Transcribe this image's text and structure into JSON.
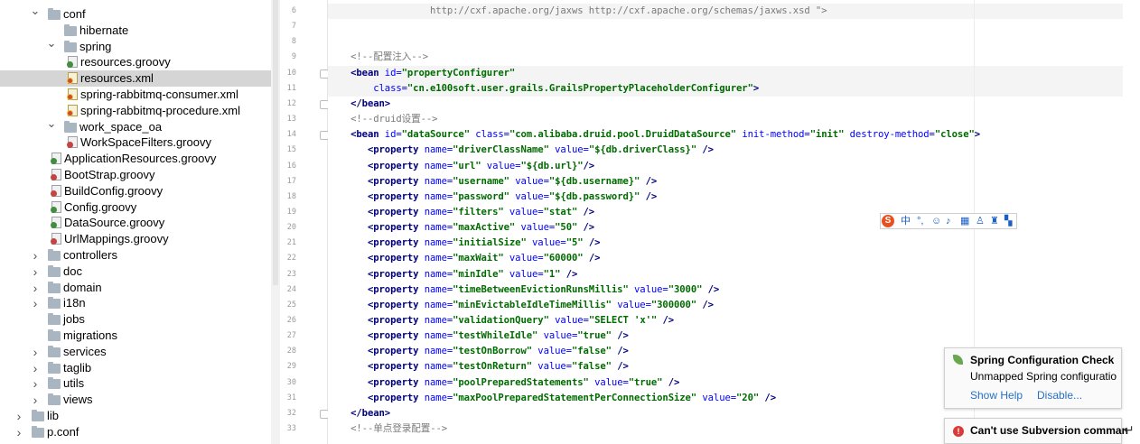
{
  "tree": [
    {
      "name": "tree-folder-conf",
      "label": "conf",
      "indent": 1,
      "type": "folder",
      "toggle": "open"
    },
    {
      "name": "tree-folder-hibernate",
      "label": "hibernate",
      "indent": 2,
      "type": "folder",
      "toggle": "none"
    },
    {
      "name": "tree-folder-spring",
      "label": "spring",
      "indent": 2,
      "type": "folder",
      "toggle": "open"
    },
    {
      "name": "tree-file-resources-groovy",
      "label": "resources.groovy",
      "indent": 3,
      "type": "groovy"
    },
    {
      "name": "tree-file-resources-xml",
      "label": "resources.xml",
      "indent": 3,
      "type": "xml",
      "selected": true
    },
    {
      "name": "tree-file-spring-rabbitmq-consumer-xml",
      "label": "spring-rabbitmq-consumer.xml",
      "indent": 3,
      "type": "xml"
    },
    {
      "name": "tree-file-spring-rabbitmq-procedure-xml",
      "label": "spring-rabbitmq-procedure.xml",
      "indent": 3,
      "type": "xml"
    },
    {
      "name": "tree-folder-work-space-oa",
      "label": "work_space_oa",
      "indent": 2,
      "type": "folder",
      "toggle": "open"
    },
    {
      "name": "tree-file-workspacefilters-groovy",
      "label": "WorkSpaceFilters.groovy",
      "indent": 3,
      "type": "groovy-red"
    },
    {
      "name": "tree-file-applicationresources-groovy",
      "label": "ApplicationResources.groovy",
      "indent": 2,
      "type": "groovy"
    },
    {
      "name": "tree-file-bootstrap-groovy",
      "label": "BootStrap.groovy",
      "indent": 2,
      "type": "groovy-red"
    },
    {
      "name": "tree-file-buildconfig-groovy",
      "label": "BuildConfig.groovy",
      "indent": 2,
      "type": "groovy-red"
    },
    {
      "name": "tree-file-config-groovy",
      "label": "Config.groovy",
      "indent": 2,
      "type": "groovy"
    },
    {
      "name": "tree-file-datasource-groovy",
      "label": "DataSource.groovy",
      "indent": 2,
      "type": "groovy"
    },
    {
      "name": "tree-file-urlmappings-groovy",
      "label": "UrlMappings.groovy",
      "indent": 2,
      "type": "groovy-red"
    },
    {
      "name": "tree-folder-controllers",
      "label": "controllers",
      "indent": 1,
      "type": "folder",
      "toggle": "closed"
    },
    {
      "name": "tree-folder-doc",
      "label": "doc",
      "indent": 1,
      "type": "folder",
      "toggle": "closed"
    },
    {
      "name": "tree-folder-domain",
      "label": "domain",
      "indent": 1,
      "type": "folder",
      "toggle": "closed"
    },
    {
      "name": "tree-folder-i18n",
      "label": "i18n",
      "indent": 1,
      "type": "folder",
      "toggle": "closed"
    },
    {
      "name": "tree-folder-jobs",
      "label": "jobs",
      "indent": 1,
      "type": "folder",
      "toggle": "none"
    },
    {
      "name": "tree-folder-migrations",
      "label": "migrations",
      "indent": 1,
      "type": "folder",
      "toggle": "none"
    },
    {
      "name": "tree-folder-services",
      "label": "services",
      "indent": 1,
      "type": "folder",
      "toggle": "closed"
    },
    {
      "name": "tree-folder-taglib",
      "label": "taglib",
      "indent": 1,
      "type": "folder",
      "toggle": "closed"
    },
    {
      "name": "tree-folder-utils",
      "label": "utils",
      "indent": 1,
      "type": "folder",
      "toggle": "closed"
    },
    {
      "name": "tree-folder-views",
      "label": "views",
      "indent": 1,
      "type": "folder",
      "toggle": "closed"
    },
    {
      "name": "tree-folder-lib",
      "label": "lib",
      "indent": 0,
      "type": "folder",
      "toggle": "closed"
    },
    {
      "name": "tree-folder-p-conf",
      "label": "p.conf",
      "indent": 0,
      "type": "folder",
      "toggle": "closed"
    }
  ],
  "code_lines": [
    {
      "n": "6",
      "hl": true,
      "parts": [
        [
          "",
          "                  "
        ],
        [
          "cm",
          "http://cxf.apache.org/jaxws http://cxf.apache.org/schemas/jaxws.xsd \">"
        ]
      ]
    },
    {
      "n": "7",
      "parts": []
    },
    {
      "n": "8",
      "parts": []
    },
    {
      "n": "9",
      "parts": [
        [
          "",
          "    "
        ],
        [
          "cm",
          "<!--配置注入-->"
        ]
      ]
    },
    {
      "n": "10",
      "fold": true,
      "hl": true,
      "parts": [
        [
          "",
          "    "
        ],
        [
          "tg",
          "<bean "
        ],
        [
          "at",
          "id="
        ],
        [
          "st",
          "\"propertyConfigurer\""
        ]
      ]
    },
    {
      "n": "11",
      "hl": true,
      "parts": [
        [
          "",
          "        "
        ],
        [
          "at",
          "class="
        ],
        [
          "st",
          "\"cn.e100soft.user.grails.GrailsPropertyPlaceholderConfigurer\""
        ],
        [
          "tg",
          ">"
        ]
      ]
    },
    {
      "n": "12",
      "fold": true,
      "parts": [
        [
          "",
          "    "
        ],
        [
          "tg",
          "</bean>"
        ]
      ]
    },
    {
      "n": "13",
      "parts": [
        [
          "",
          "    "
        ],
        [
          "cm",
          "<!--druid设置-->"
        ]
      ]
    },
    {
      "n": "14",
      "fold": true,
      "parts": [
        [
          "",
          "    "
        ],
        [
          "tg",
          "<bean "
        ],
        [
          "at",
          "id="
        ],
        [
          "st",
          "\"dataSource\" "
        ],
        [
          "at",
          "class="
        ],
        [
          "st",
          "\"com.alibaba.druid.pool.DruidDataSource\" "
        ],
        [
          "at",
          "init-method="
        ],
        [
          "st",
          "\"init\" "
        ],
        [
          "at",
          "destroy-method="
        ],
        [
          "st",
          "\"close\""
        ],
        [
          "tg",
          ">"
        ]
      ]
    },
    {
      "n": "15",
      "parts": [
        [
          "",
          "       "
        ],
        [
          "tg",
          "<property "
        ],
        [
          "at",
          "name="
        ],
        [
          "st",
          "\"driverClassName\" "
        ],
        [
          "at",
          "value="
        ],
        [
          "st",
          "\"${db.driverClass}\" "
        ],
        [
          "tg",
          "/>"
        ]
      ]
    },
    {
      "n": "16",
      "parts": [
        [
          "",
          "       "
        ],
        [
          "tg",
          "<property "
        ],
        [
          "at",
          "name="
        ],
        [
          "st",
          "\"url\" "
        ],
        [
          "at",
          "value="
        ],
        [
          "st",
          "\"${db.url}\""
        ],
        [
          "tg",
          "/>"
        ]
      ]
    },
    {
      "n": "17",
      "parts": [
        [
          "",
          "       "
        ],
        [
          "tg",
          "<property "
        ],
        [
          "at",
          "name="
        ],
        [
          "st",
          "\"username\" "
        ],
        [
          "at",
          "value="
        ],
        [
          "st",
          "\"${db.username}\" "
        ],
        [
          "tg",
          "/>"
        ]
      ]
    },
    {
      "n": "18",
      "parts": [
        [
          "",
          "       "
        ],
        [
          "tg",
          "<property "
        ],
        [
          "at",
          "name="
        ],
        [
          "st",
          "\"password\" "
        ],
        [
          "at",
          "value="
        ],
        [
          "st",
          "\"${db.password}\" "
        ],
        [
          "tg",
          "/>"
        ]
      ]
    },
    {
      "n": "19",
      "parts": [
        [
          "",
          "       "
        ],
        [
          "tg",
          "<property "
        ],
        [
          "at",
          "name="
        ],
        [
          "st",
          "\"filters\" "
        ],
        [
          "at",
          "value="
        ],
        [
          "st",
          "\"stat\" "
        ],
        [
          "tg",
          "/>"
        ]
      ]
    },
    {
      "n": "20",
      "parts": [
        [
          "",
          "       "
        ],
        [
          "tg",
          "<property "
        ],
        [
          "at",
          "name="
        ],
        [
          "st",
          "\"maxActive\" "
        ],
        [
          "at",
          "value="
        ],
        [
          "st",
          "\"50\" "
        ],
        [
          "tg",
          "/>"
        ]
      ]
    },
    {
      "n": "21",
      "parts": [
        [
          "",
          "       "
        ],
        [
          "tg",
          "<property "
        ],
        [
          "at",
          "name="
        ],
        [
          "st",
          "\"initialSize\" "
        ],
        [
          "at",
          "value="
        ],
        [
          "st",
          "\"5\" "
        ],
        [
          "tg",
          "/>"
        ]
      ]
    },
    {
      "n": "22",
      "parts": [
        [
          "",
          "       "
        ],
        [
          "tg",
          "<property "
        ],
        [
          "at",
          "name="
        ],
        [
          "st",
          "\"maxWait\" "
        ],
        [
          "at",
          "value="
        ],
        [
          "st",
          "\"60000\" "
        ],
        [
          "tg",
          "/>"
        ]
      ]
    },
    {
      "n": "23",
      "parts": [
        [
          "",
          "       "
        ],
        [
          "tg",
          "<property "
        ],
        [
          "at",
          "name="
        ],
        [
          "st",
          "\"minIdle\" "
        ],
        [
          "at",
          "value="
        ],
        [
          "st",
          "\"1\" "
        ],
        [
          "tg",
          "/>"
        ]
      ]
    },
    {
      "n": "24",
      "parts": [
        [
          "",
          "       "
        ],
        [
          "tg",
          "<property "
        ],
        [
          "at",
          "name="
        ],
        [
          "st",
          "\"timeBetweenEvictionRunsMillis\" "
        ],
        [
          "at",
          "value="
        ],
        [
          "st",
          "\"3000\" "
        ],
        [
          "tg",
          "/>"
        ]
      ]
    },
    {
      "n": "25",
      "parts": [
        [
          "",
          "       "
        ],
        [
          "tg",
          "<property "
        ],
        [
          "at",
          "name="
        ],
        [
          "st",
          "\"minEvictableIdleTimeMillis\" "
        ],
        [
          "at",
          "value="
        ],
        [
          "st",
          "\"300000\" "
        ],
        [
          "tg",
          "/>"
        ]
      ]
    },
    {
      "n": "26",
      "parts": [
        [
          "",
          "       "
        ],
        [
          "tg",
          "<property "
        ],
        [
          "at",
          "name="
        ],
        [
          "st",
          "\"validationQuery\" "
        ],
        [
          "at",
          "value="
        ],
        [
          "st",
          "\"SELECT 'x'\" "
        ],
        [
          "tg",
          "/>"
        ]
      ]
    },
    {
      "n": "27",
      "parts": [
        [
          "",
          "       "
        ],
        [
          "tg",
          "<property "
        ],
        [
          "at",
          "name="
        ],
        [
          "st",
          "\"testWhileIdle\" "
        ],
        [
          "at",
          "value="
        ],
        [
          "st",
          "\"true\" "
        ],
        [
          "tg",
          "/>"
        ]
      ]
    },
    {
      "n": "28",
      "parts": [
        [
          "",
          "       "
        ],
        [
          "tg",
          "<property "
        ],
        [
          "at",
          "name="
        ],
        [
          "st",
          "\"testOnBorrow\" "
        ],
        [
          "at",
          "value="
        ],
        [
          "st",
          "\"false\" "
        ],
        [
          "tg",
          "/>"
        ]
      ]
    },
    {
      "n": "29",
      "parts": [
        [
          "",
          "       "
        ],
        [
          "tg",
          "<property "
        ],
        [
          "at",
          "name="
        ],
        [
          "st",
          "\"testOnReturn\" "
        ],
        [
          "at",
          "value="
        ],
        [
          "st",
          "\"false\" "
        ],
        [
          "tg",
          "/>"
        ]
      ]
    },
    {
      "n": "30",
      "parts": [
        [
          "",
          "       "
        ],
        [
          "tg",
          "<property "
        ],
        [
          "at",
          "name="
        ],
        [
          "st",
          "\"poolPreparedStatements\" "
        ],
        [
          "at",
          "value="
        ],
        [
          "st",
          "\"true\" "
        ],
        [
          "tg",
          "/>"
        ]
      ]
    },
    {
      "n": "31",
      "parts": [
        [
          "",
          "       "
        ],
        [
          "tg",
          "<property "
        ],
        [
          "at",
          "name="
        ],
        [
          "st",
          "\"maxPoolPreparedStatementPerConnectionSize\" "
        ],
        [
          "at",
          "value="
        ],
        [
          "st",
          "\"20\" "
        ],
        [
          "tg",
          "/>"
        ]
      ]
    },
    {
      "n": "32",
      "fold": true,
      "parts": [
        [
          "",
          "    "
        ],
        [
          "tg",
          "</bean>"
        ]
      ]
    },
    {
      "n": "33",
      "parts": [
        [
          "",
          "    "
        ],
        [
          "cm",
          "<!--单点登录配置-->"
        ]
      ]
    }
  ],
  "ime": {
    "logo": "S",
    "lang": "中",
    "punct": "°,"
  },
  "notifications": {
    "spring": {
      "title": "Spring Configuration Check",
      "body": "Unmapped Spring configuratio",
      "show_help": "Show Help",
      "disable": "Disable..."
    },
    "svn": {
      "title": "Can't use Subversion comman"
    }
  },
  "colors": {
    "accent_link": "#2770c6",
    "selection": "#d5d5d5"
  }
}
